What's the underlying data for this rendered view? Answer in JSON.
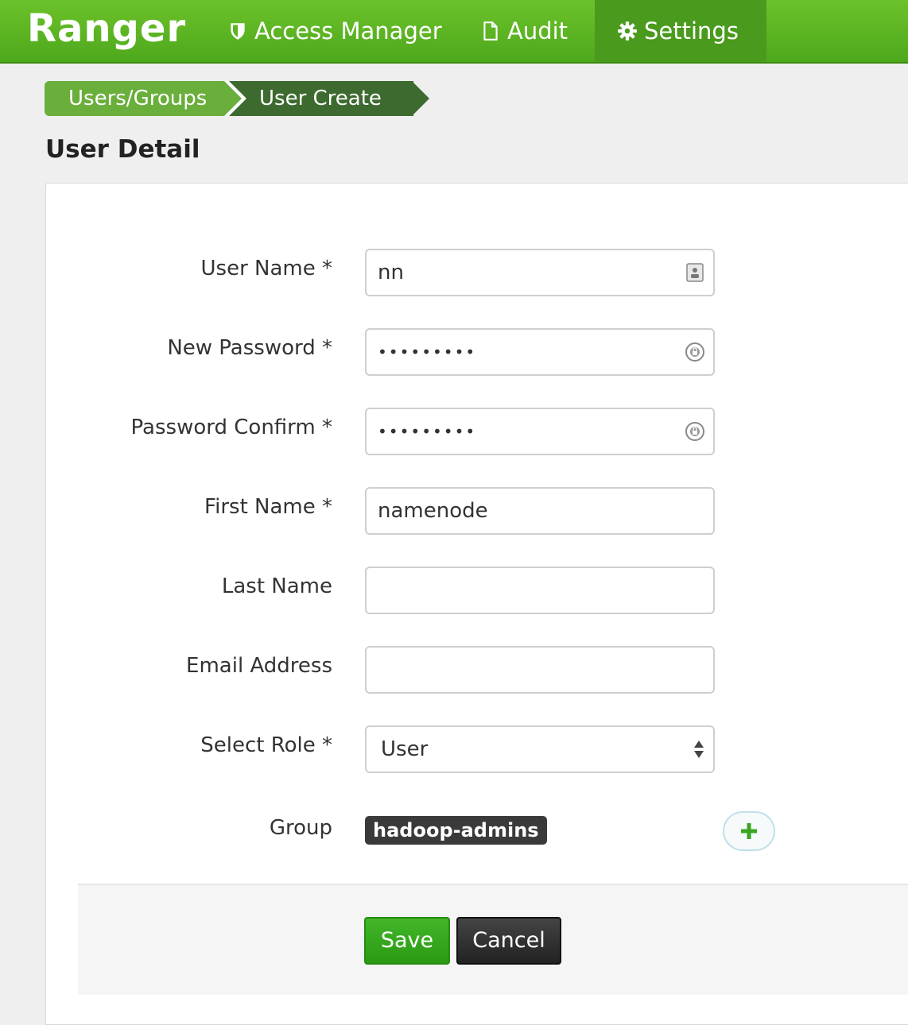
{
  "navbar": {
    "brand": "Ranger",
    "items": [
      {
        "label": "Access Manager",
        "icon": "shield-icon"
      },
      {
        "label": "Audit",
        "icon": "file-icon"
      },
      {
        "label": "Settings",
        "icon": "gear-icon",
        "active": true
      }
    ]
  },
  "breadcrumb": [
    "Users/Groups",
    "User Create"
  ],
  "page_title": "User Detail",
  "form": {
    "fields": [
      {
        "label": "User Name *",
        "value": "nn",
        "icon": "contact-card-icon"
      },
      {
        "label": "New Password *",
        "value": "•••••••••",
        "icon": "password-manager-icon"
      },
      {
        "label": "Password Confirm *",
        "value": "•••••••••",
        "icon": "password-manager-icon"
      },
      {
        "label": "First Name *",
        "value": "namenode"
      },
      {
        "label": "Last Name",
        "value": ""
      },
      {
        "label": "Email Address",
        "value": ""
      },
      {
        "label": "Select Role *",
        "value": "User"
      }
    ],
    "group": {
      "label": "Group",
      "tags": [
        "hadoop-admins"
      ]
    },
    "save_label": "Save",
    "cancel_label": "Cancel"
  },
  "colors": {
    "navbar_green": "#5bb521",
    "breadcrumb_light": "#6aae3c",
    "breadcrumb_dark": "#3d6a2f",
    "save_green": "#2a9a12",
    "cancel_dark": "#222222"
  }
}
